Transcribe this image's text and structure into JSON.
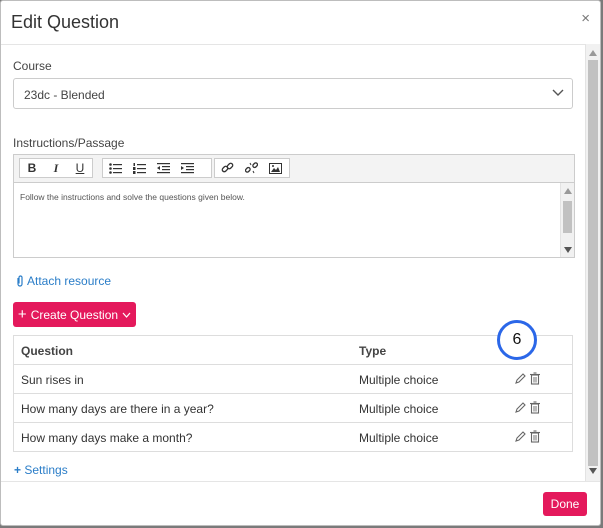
{
  "dialog": {
    "title": "Edit Question",
    "close_label": "×"
  },
  "course": {
    "label": "Course",
    "value": "23dc - Blended"
  },
  "instructions": {
    "label": "Instructions/Passage",
    "content": "Follow the instructions and solve the questions given below."
  },
  "toolbar": {
    "bold": "B",
    "italic": "I",
    "underline": "U"
  },
  "attach": {
    "label": "Attach resource"
  },
  "create": {
    "label": "Create Question"
  },
  "table": {
    "headers": {
      "question": "Question",
      "type": "Type"
    },
    "rows": [
      {
        "question": "Sun rises in",
        "type": "Multiple choice"
      },
      {
        "question": "How many days are there in a year?",
        "type": "Multiple choice"
      },
      {
        "question": "How many days make a month?",
        "type": "Multiple choice"
      }
    ]
  },
  "annotation": {
    "badge": "6"
  },
  "settings": {
    "label": "Settings"
  },
  "footer": {
    "done_label": "Done"
  },
  "colors": {
    "accent": "#e4195c",
    "link": "#2a7dc8",
    "badge_ring": "#2b67e8"
  }
}
